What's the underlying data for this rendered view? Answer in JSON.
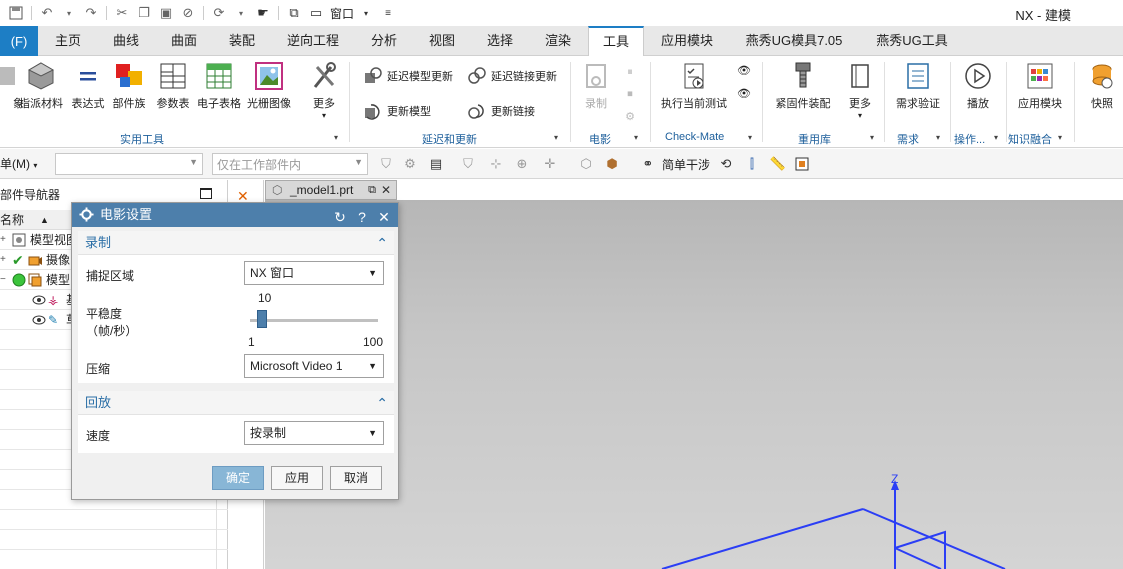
{
  "app": {
    "title": "NX - 建模",
    "window_label": "窗口"
  },
  "tabs": {
    "file": "(F)",
    "items": [
      "主页",
      "曲线",
      "曲面",
      "装配",
      "逆向工程",
      "分析",
      "视图",
      "选择",
      "渲染",
      "工具",
      "应用模块",
      "燕秀UG模具7.05",
      "燕秀UG工具"
    ],
    "active": "工具"
  },
  "ribbon": {
    "utility_buttons": [
      "象",
      "指派材料",
      "表达式",
      "部件族",
      "参数表",
      "电子表格",
      "光栅图像",
      "更多"
    ],
    "group_utility": "实用工具",
    "delay_items": [
      "延迟模型更新",
      "延迟链接更新",
      "更新模型",
      "更新链接"
    ],
    "group_delay": "延迟和更新",
    "record_label": "录制",
    "group_movie": "电影",
    "checkmate_button": "执行当前测试",
    "group_checkmate": "Check-Mate",
    "fastener_button": "紧固件装配",
    "more_label": "更多",
    "group_reuse": "重用库",
    "req_button": "需求验证",
    "group_req": "需求",
    "play_button": "播放",
    "group_ops": "操作...",
    "appmodule_button": "应用模块",
    "group_knowledge": "知识融合",
    "snapshot_button": "快照"
  },
  "toolbar2": {
    "menu_label": "单(M)",
    "filter_placeholder": "",
    "scope_label": "仅在工作部件内",
    "simple_interference": "简单干涉"
  },
  "navigator": {
    "title": "部件导航器",
    "column_name": "名称",
    "rows": [
      {
        "toggle": "+",
        "label": "模型视图"
      },
      {
        "toggle": "+",
        "label": "摄像"
      },
      {
        "toggle": "−",
        "label": "模型"
      },
      {
        "toggle": "",
        "label": "基"
      },
      {
        "toggle": "",
        "label": "草"
      }
    ]
  },
  "viewport": {
    "tab_label": "_model1.prt",
    "axis_label": "Z"
  },
  "dialog": {
    "title": "电影设置",
    "record_section": "录制",
    "capture_label": "捕捉区域",
    "capture_value": "NX 窗口",
    "smooth_label": "平稳度",
    "smooth_unit": "（帧/秒）",
    "smooth_value": "10",
    "smooth_min": "1",
    "smooth_max": "100",
    "smooth_fraction": 0.09,
    "compress_label": "压缩",
    "compress_value": "Microsoft Video 1",
    "playback_section": "回放",
    "speed_label": "速度",
    "speed_value": "按录制",
    "ok": "确定",
    "apply": "应用",
    "cancel": "取消"
  },
  "colors": {
    "accent": "#1d7ec5",
    "dialog_title": "#4d7fab",
    "axis": "#2b3ef5"
  }
}
